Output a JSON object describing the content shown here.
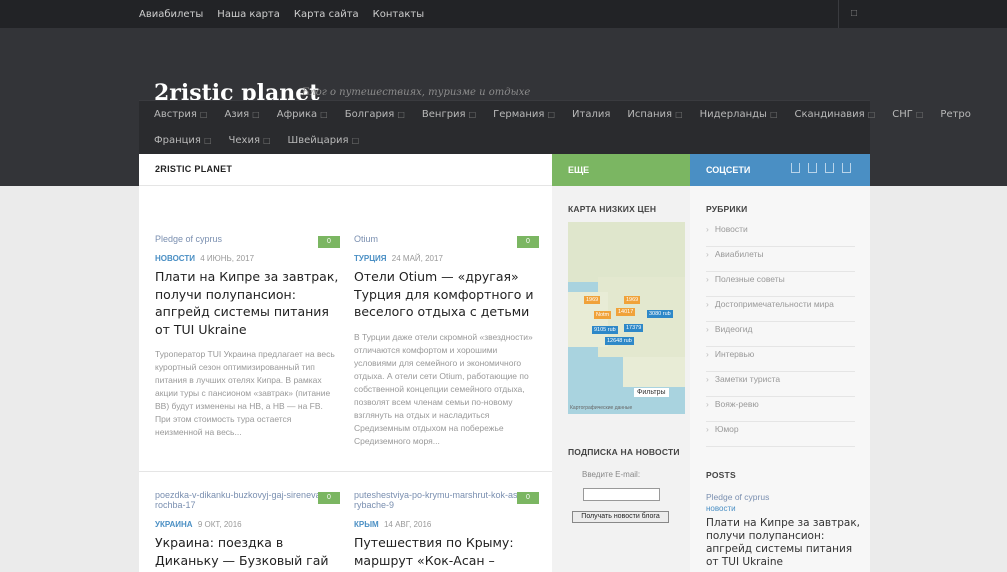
{
  "topnav": [
    "Авиабилеты",
    "Наша карта",
    "Карта сайта",
    "Контакты"
  ],
  "site": {
    "title": "2ristic planet",
    "tagline": "Блог о путешествиях, туризме и отдыхе"
  },
  "mainnav_row1": [
    "Австрия",
    "Азия",
    "Африка",
    "Болгария",
    "Венгрия",
    "Германия",
    "Италия",
    "Испания",
    "Нидерланды",
    "Скандинавия",
    "СНГ",
    "Ретро"
  ],
  "mainnav_row2": [
    "Франция",
    "Чехия",
    "Швейцария"
  ],
  "content": {
    "heading": "2RISTIC PLANET",
    "posts": [
      {
        "img_alt": "Pledge of cyprus",
        "comments": "0",
        "category": "НОВОСТИ",
        "date": "4 ИЮНЬ, 2017",
        "title": "Плати на Кипре за завтрак, получи полупансион: апгрейд системы питания от TUI Ukraine",
        "excerpt": "Туроператор TUI Украина предлагает на весь курортный сезон оптимизированный тип питания в лучших отелях Кипра. В рамках акции туры с пансионом «завтрак» (питание BB) будут изменены на HB, а HB — на FB. При этом стоимость тура остается неизменной на весь..."
      },
      {
        "img_alt": "Otium",
        "comments": "0",
        "category": "ТУРЦИЯ",
        "date": "24 МАЙ, 2017",
        "title": "Отели Otium — «другая» Турция для комфортного и веселого отдыха с детьми",
        "excerpt": "В Турции даже отели скромной «звездности» отличаются комфортом и хорошими условиями для семейного и экономичного отдыха. А отели сети Otium, работающие по собственной концепции семейного отдыха, позволят всем членам семьи по-новому взглянуть на отдых и насладиться Средиземным отдыхом на побережье Средиземного моря..."
      },
      {
        "img_alt": "poezdka-v-dikanku-buzkovyj-gaj-sirenevaya-rochba-17",
        "comments": "0",
        "category": "УКРАИНА",
        "date": "9 ОКТ, 2016",
        "title": "Украина: поездка в Диканьку — Бузковый гай",
        "excerpt": ""
      },
      {
        "img_alt": "puteshestviya-po-krymu-marshrut-kok-asan-rybache-9",
        "comments": "0",
        "category": "КРЫМ",
        "date": "14 АВГ, 2016",
        "title": "Путешествия по Крыму: маршрут «Кок-Асан –",
        "excerpt": ""
      }
    ]
  },
  "more": {
    "heading": "ЕЩЕ",
    "map_title": "КАРТА НИЗКИХ ЦЕН",
    "map_pins": [
      "1969",
      "1969",
      "Notm",
      "14017",
      "3080 rub",
      "9105 rub",
      "17379",
      "12648 rub"
    ],
    "map_filter": "Фильтры",
    "map_credit": "Картографические данные",
    "subscribe_title": "ПОДПИСКА НА НОВОСТИ",
    "subscribe_label": "Введите E-mail:",
    "subscribe_button": "Получать новости блога"
  },
  "social": {
    "heading": "СОЦСЕТИ",
    "rubrics_title": "РУБРИКИ",
    "rubrics": [
      "Новости",
      "Авиабилеты",
      "Полезные советы",
      "Достопримечательности мира",
      "Видеогид",
      "Интервью",
      "Заметки туриста",
      "Вояж-ревю",
      "Юмор"
    ],
    "posts_title": "POSTS",
    "posts": [
      {
        "img_alt": "Pledge of cyprus",
        "category": "новости",
        "title": "Плати на Кипре за завтрак, получи полупансион: апгрейд системы питания от TUI Ukraine"
      }
    ]
  },
  "colors": {
    "accent_green": "#7bb662",
    "accent_blue": "#4a8fc4",
    "header_bg": "#333438",
    "topbar_bg": "#222326"
  }
}
